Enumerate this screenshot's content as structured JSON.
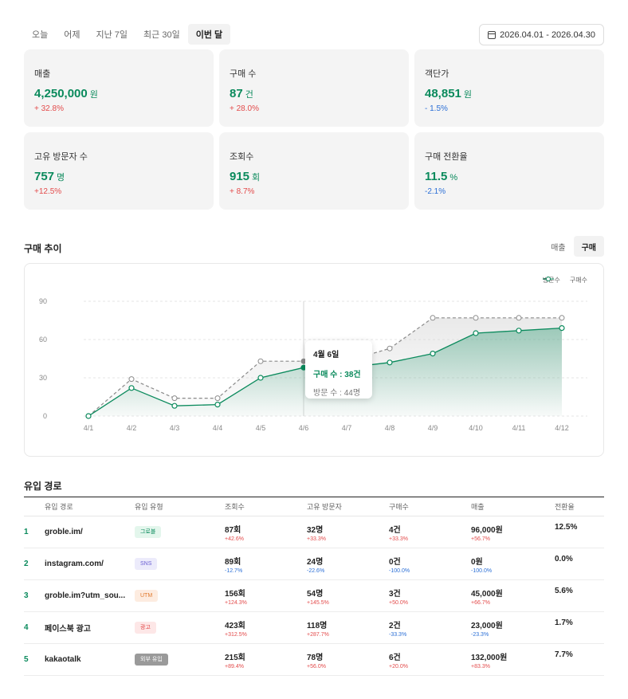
{
  "period_tabs": [
    "오늘",
    "어제",
    "지난 7일",
    "최근 30일",
    "이번 달"
  ],
  "date_range": "2026.04.01 - 2026.04.30",
  "cards": [
    {
      "label": "매출",
      "value": "4,250,000",
      "unit": "원",
      "change": "+ 32.8%",
      "trend": "up"
    },
    {
      "label": "구매 수",
      "value": "87",
      "unit": "건",
      "change": "+ 28.0%",
      "trend": "up"
    },
    {
      "label": "객단가",
      "value": "48,851",
      "unit": "원",
      "change": "- 1.5%",
      "trend": "down"
    },
    {
      "label": "고유 방문자 수",
      "value": "757",
      "unit": "명",
      "change": "+12.5%",
      "trend": "up"
    },
    {
      "label": "조회수",
      "value": "915",
      "unit": "회",
      "change": "+ 8.7%",
      "trend": "up"
    },
    {
      "label": "구매 전환율",
      "value": "11.5",
      "unit": "%",
      "change": "-2.1%",
      "trend": "down"
    }
  ],
  "chart_section": {
    "title": "구매 추이",
    "toggle": [
      "매출",
      "구매"
    ]
  },
  "chart_data": {
    "type": "line",
    "x": [
      "4/1",
      "4/2",
      "4/3",
      "4/4",
      "4/5",
      "4/6",
      "4/7",
      "4/8",
      "4/9",
      "4/10",
      "4/11",
      "4/12"
    ],
    "yticks": [
      0,
      30,
      60,
      90
    ],
    "ylim": [
      0,
      90
    ],
    "series": [
      {
        "name": "방문수",
        "values": [
          0,
          29,
          14,
          14,
          43,
          43,
          43,
          53,
          77,
          77,
          77,
          77
        ],
        "color": "#8a8a8a"
      },
      {
        "name": "구매수",
        "values": [
          0,
          22,
          8,
          9,
          30,
          38,
          38,
          42,
          49,
          65,
          67,
          69
        ],
        "color": "#0a8a5c"
      }
    ],
    "tooltip": {
      "title": "4월 6일",
      "line1": "구매 수 : 38건",
      "line2": "방문 수 : 44명",
      "index": 5
    }
  },
  "traffic_section": {
    "title": "유입 경로",
    "headers": [
      "",
      "유입 경로",
      "유입 유형",
      "조회수",
      "고유 방문자",
      "구매수",
      "매출",
      "전환율"
    ],
    "rows": [
      {
        "rank": "1",
        "source": "groble.im/",
        "type": "그로블",
        "type_style": "green",
        "views": "87회",
        "views_chg": "+42.6%",
        "views_trend": "up",
        "visitors": "32명",
        "visitors_chg": "+33.3%",
        "visitors_trend": "up",
        "purchases": "4건",
        "purchases_chg": "+33.3%",
        "purchases_trend": "up",
        "revenue": "96,000원",
        "revenue_chg": "+56.7%",
        "revenue_trend": "up",
        "conversion": "12.5%"
      },
      {
        "rank": "2",
        "source": "instagram.com/",
        "type": "SNS",
        "type_style": "purple",
        "views": "89회",
        "views_chg": "-12.7%",
        "views_trend": "down",
        "visitors": "24명",
        "visitors_chg": "-22.6%",
        "visitors_trend": "down",
        "purchases": "0건",
        "purchases_chg": "-100.0%",
        "purchases_trend": "down",
        "revenue": "0원",
        "revenue_chg": "-100.0%",
        "revenue_trend": "down",
        "conversion": "0.0%"
      },
      {
        "rank": "3",
        "source": "groble.im?utm_sou...",
        "type": "UTM",
        "type_style": "orange",
        "views": "156회",
        "views_chg": "+124.3%",
        "views_trend": "up",
        "visitors": "54명",
        "visitors_chg": "+145.5%",
        "visitors_trend": "up",
        "purchases": "3건",
        "purchases_chg": "+50.0%",
        "purchases_trend": "up",
        "revenue": "45,000원",
        "revenue_chg": "+66.7%",
        "revenue_trend": "up",
        "conversion": "5.6%"
      },
      {
        "rank": "4",
        "source": "페이스북 광고",
        "type": "광고",
        "type_style": "red",
        "views": "423회",
        "views_chg": "+312.5%",
        "views_trend": "up",
        "visitors": "118명",
        "visitors_chg": "+287.7%",
        "visitors_trend": "up",
        "purchases": "2건",
        "purchases_chg": "-33.3%",
        "purchases_trend": "down",
        "revenue": "23,000원",
        "revenue_chg": "-23.3%",
        "revenue_trend": "down",
        "conversion": "1.7%"
      },
      {
        "rank": "5",
        "source": "kakaotalk",
        "type": "외부 유입",
        "type_style": "gray",
        "views": "215회",
        "views_chg": "+89.4%",
        "views_trend": "up",
        "visitors": "78명",
        "visitors_chg": "+56.0%",
        "visitors_trend": "up",
        "purchases": "6건",
        "purchases_chg": "+20.0%",
        "purchases_trend": "up",
        "revenue": "132,000원",
        "revenue_chg": "+83.3%",
        "revenue_trend": "up",
        "conversion": "7.7%"
      }
    ]
  }
}
